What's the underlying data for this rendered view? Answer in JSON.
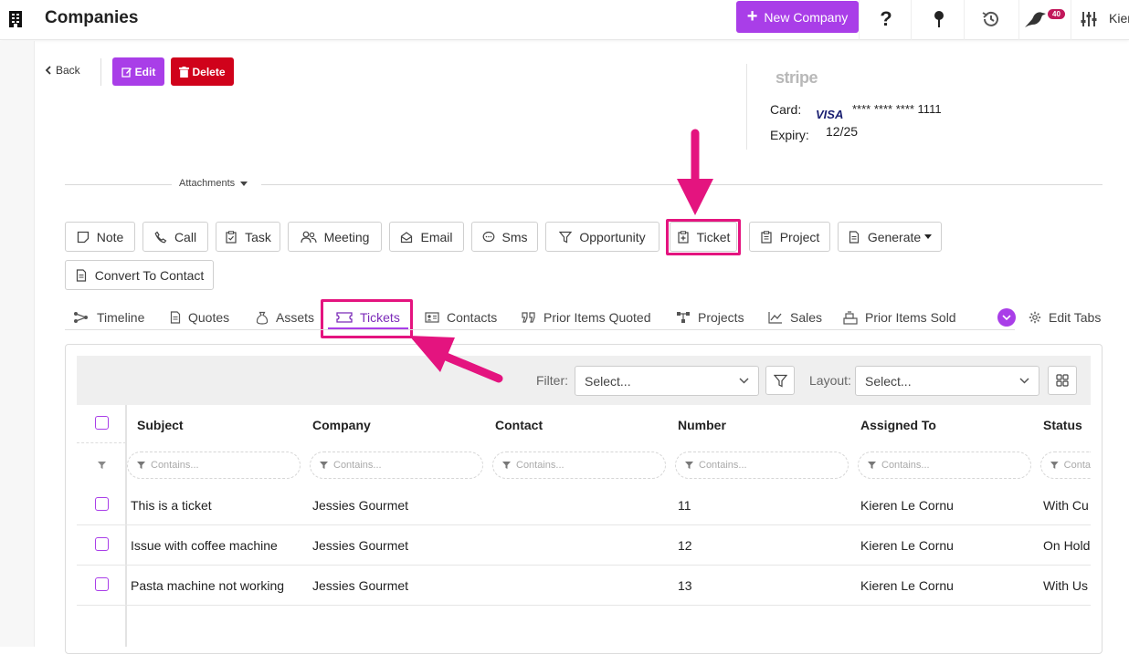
{
  "header": {
    "title": "Companies",
    "new_button": "New Company",
    "notification_count": "40",
    "user_name": "Kier"
  },
  "actions": {
    "back": "Back",
    "edit": "Edit",
    "delete": "Delete"
  },
  "payment": {
    "provider": "stripe",
    "card_label": "Card:",
    "card_brand": "VISA",
    "card_number": "**** **** **** 1111",
    "expiry_label": "Expiry:",
    "expiry": "12/25"
  },
  "attachments_label": "Attachments",
  "activity_buttons": {
    "note": "Note",
    "call": "Call",
    "task": "Task",
    "meeting": "Meeting",
    "email": "Email",
    "sms": "Sms",
    "opportunity": "Opportunity",
    "ticket": "Ticket",
    "project": "Project",
    "generate": "Generate",
    "convert": "Convert To Contact"
  },
  "tabs": {
    "timeline": "Timeline",
    "quotes": "Quotes",
    "assets": "Assets",
    "tickets": "Tickets",
    "contacts": "Contacts",
    "prior_items_quoted": "Prior Items Quoted",
    "projects": "Projects",
    "sales": "Sales",
    "prior_items_sold": "Prior Items Sold",
    "edit_tabs": "Edit Tabs",
    "active": "tickets"
  },
  "grid": {
    "filter_label": "Filter:",
    "filter_placeholder": "Select...",
    "layout_label": "Layout:",
    "layout_placeholder": "Select...",
    "filter_input_placeholder": "Contains...",
    "filter_input_truncated": "Conta",
    "columns": {
      "subject": "Subject",
      "company": "Company",
      "contact": "Contact",
      "number": "Number",
      "assigned_to": "Assigned To",
      "status": "Status"
    },
    "rows": [
      {
        "subject": "This is a ticket",
        "company": "Jessies Gourmet",
        "contact": "",
        "number": "11",
        "assigned_to": "Kieren Le Cornu",
        "status": "With Cu"
      },
      {
        "subject": "Issue with coffee machine",
        "company": "Jessies Gourmet",
        "contact": "",
        "number": "12",
        "assigned_to": "Kieren Le Cornu",
        "status": "On Hold"
      },
      {
        "subject": "Pasta machine not working",
        "company": "Jessies Gourmet",
        "contact": "",
        "number": "13",
        "assigned_to": "Kieren Le Cornu",
        "status": "With Us"
      }
    ]
  },
  "colors": {
    "accent": "#a93ee8",
    "danger": "#d0021b",
    "highlight": "#e4147f"
  }
}
